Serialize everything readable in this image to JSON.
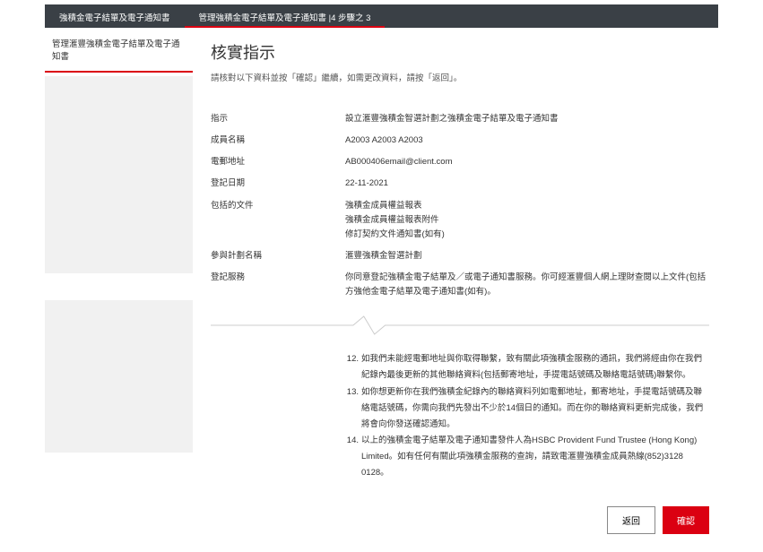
{
  "tabs": {
    "tab1": "強積金電子結單及電子通知書",
    "tab2": "管理強積金電子結單及電子通知書  |4 步驟之 3"
  },
  "sidebar": {
    "subTab": "管理滙豐強積金電子結單及電子通知書"
  },
  "header": {
    "title": "核實指示",
    "intro": "請核對以下資料並按「確認」繼續，如需更改資料，請按「返回」。"
  },
  "rows": {
    "instruction": {
      "label": "指示",
      "value": "設立滙豐強積金智選計劃之強積金電子結單及電子通知書"
    },
    "memberName": {
      "label": "成員名稱",
      "value": "A2003 A2003 A2003"
    },
    "email": {
      "label": "電郵地址",
      "value": "AB000406email@client.com"
    },
    "regDate": {
      "label": "登記日期",
      "value": "22-11-2021"
    },
    "documents": {
      "label": "包括的文件",
      "line1": "強積金成員權益報表",
      "line2": "強積金成員權益報表附件",
      "line3": "修訂契約文件通知書(如有)"
    },
    "plan": {
      "label": "參與計劃名稱",
      "value": "滙豐強積金智選計劃"
    },
    "regService": {
      "label": "登記服務",
      "value": "你同意登記強積金電子結單及／或電子通知書服務。你可經滙豐個人網上理財查閱以上文件(包括方強他金電子結單及電子通知書(如有)。"
    }
  },
  "list": {
    "item12": {
      "num": "12.",
      "text": "如我們未能經電郵地址與你取得聯繫，致有關此項強積金服務的通訊，我們將經由你在我們紀錄內最後更新的其他聯絡資料(包括郵寄地址，手提電話號碼及聯絡電話號碼)聯繫你。"
    },
    "item13": {
      "num": "13.",
      "text": "如你想更新你在我們強積金紀錄內的聯絡資料列如電郵地址，郵寄地址，手提電話號碼及聯絡電話號碼，你需向我們先發出不少於14個日的通知。而在你的聯絡資料更新完成後，我們將會向你發送確認通知。"
    },
    "item14": {
      "num": "14.",
      "text": "以上的強積金電子結單及電子通知書發件人為HSBC Provident Fund Trustee (Hong Kong) Limited。如有任何有關此項強積金服務的查詢，請致電滙豐強積金成員熱線(852)3128 0128。"
    }
  },
  "buttons": {
    "back": "返回",
    "confirm": "確認"
  }
}
